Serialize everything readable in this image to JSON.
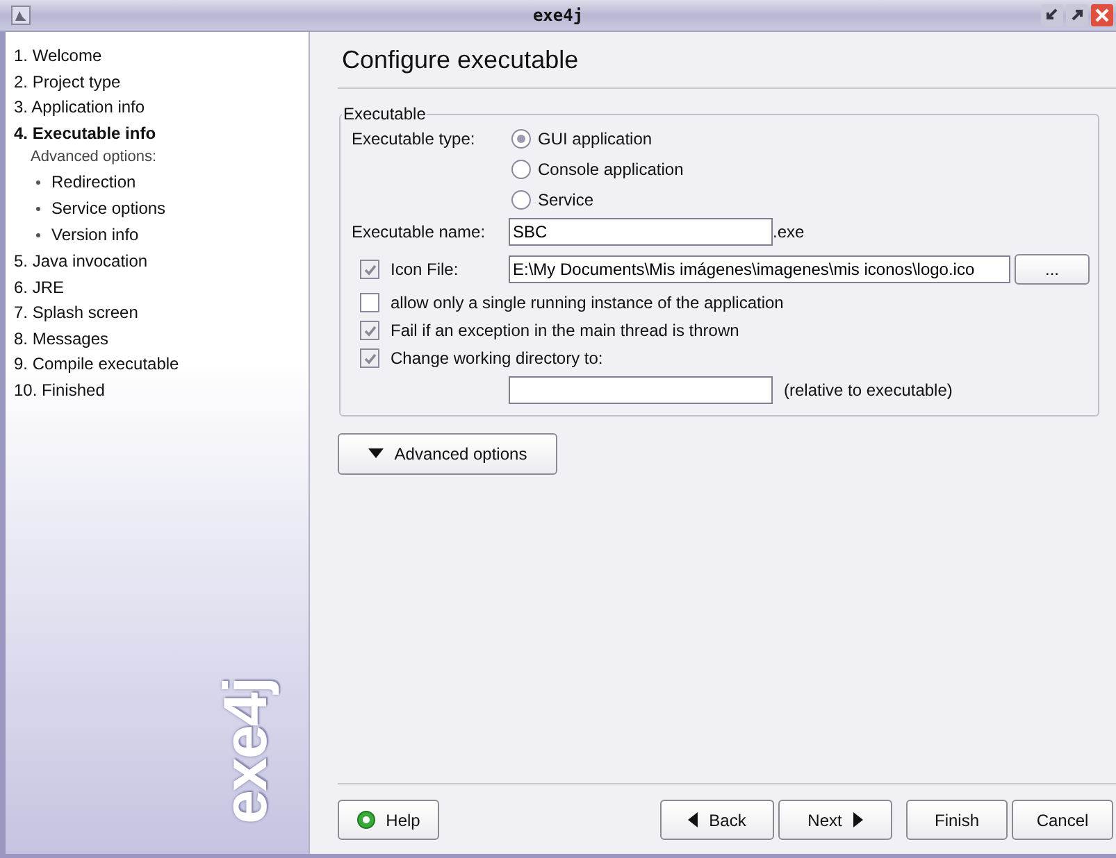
{
  "window": {
    "title": "exe4j"
  },
  "sidebar": {
    "steps": [
      {
        "label": "1. Welcome",
        "selected": false
      },
      {
        "label": "2. Project type",
        "selected": false
      },
      {
        "label": "3. Application info",
        "selected": false
      },
      {
        "label": "4. Executable info",
        "selected": true,
        "children": [
          {
            "kind": "heading",
            "label": "Advanced options:"
          },
          {
            "kind": "option",
            "label": "Redirection"
          },
          {
            "kind": "option",
            "label": "Service options"
          },
          {
            "kind": "option",
            "label": "Version info"
          }
        ]
      },
      {
        "label": "5. Java invocation",
        "selected": false
      },
      {
        "label": "6. JRE",
        "selected": false
      },
      {
        "label": "7. Splash screen",
        "selected": false
      },
      {
        "label": "8. Messages",
        "selected": false
      },
      {
        "label": "9. Compile executable",
        "selected": false
      },
      {
        "label": "10. Finished",
        "selected": false
      }
    ],
    "logo": "exe4j"
  },
  "page": {
    "title": "Configure executable",
    "group": {
      "title": "Executable",
      "type_label": "Executable type:",
      "types": [
        {
          "label": "GUI application",
          "selected": true
        },
        {
          "label": "Console application",
          "selected": false
        },
        {
          "label": "Service",
          "selected": false
        }
      ],
      "name_label": "Executable name:",
      "name_value": "SBC",
      "name_suffix": ".exe",
      "icon_file": {
        "label": "Icon File:",
        "checked": true,
        "value": "E:\\My Documents\\Mis imágenes\\imagenes\\mis iconos\\logo.ico",
        "browse": "..."
      },
      "options": [
        {
          "label": "allow only a single running instance of the application",
          "checked": false
        },
        {
          "label": "Fail if an exception in the main thread is thrown",
          "checked": true
        },
        {
          "label": "Change working directory to:",
          "checked": true
        }
      ],
      "workdir_hint": "(relative to executable)"
    },
    "advanced_button": "Advanced options"
  },
  "buttons": {
    "help": "Help",
    "back": "Back",
    "next": "Next",
    "finish": "Finish",
    "cancel": "Cancel"
  }
}
